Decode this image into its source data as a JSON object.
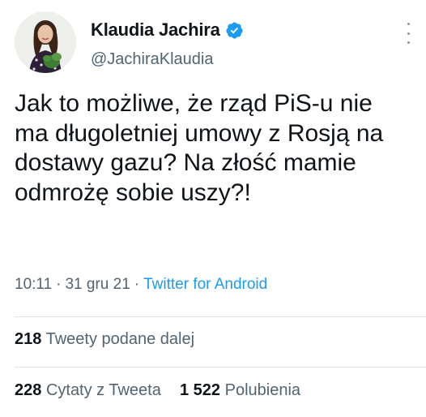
{
  "author": {
    "display_name": "Klaudia Jachira",
    "handle": "@JachiraKlaudia",
    "verified": true,
    "avatar_icon": "profile-photo"
  },
  "tweet": {
    "text": "Jak to możliwe, że rząd PiS-u nie ma długoletniej umowy z Rosją na dostawy gazu? Na złość mamie odmrożę sobie uszy?!",
    "time": "10:11",
    "date": "31 gru 21",
    "separator": "·",
    "source": "Twitter for Android"
  },
  "stats": {
    "retweets_count": "218",
    "retweets_label": "Tweety podane dalej",
    "quotes_count": "228",
    "quotes_label": "Cytaty z Tweeta",
    "likes_count": "1 522",
    "likes_label": "Polubienia"
  },
  "colors": {
    "link": "#1d9bf0",
    "secondary_text": "#536471",
    "primary_text": "#0f1419",
    "verified_badge": "#1d9bf0"
  },
  "icons": {
    "verified": "verified-badge-icon",
    "more": "more-options-icon"
  }
}
